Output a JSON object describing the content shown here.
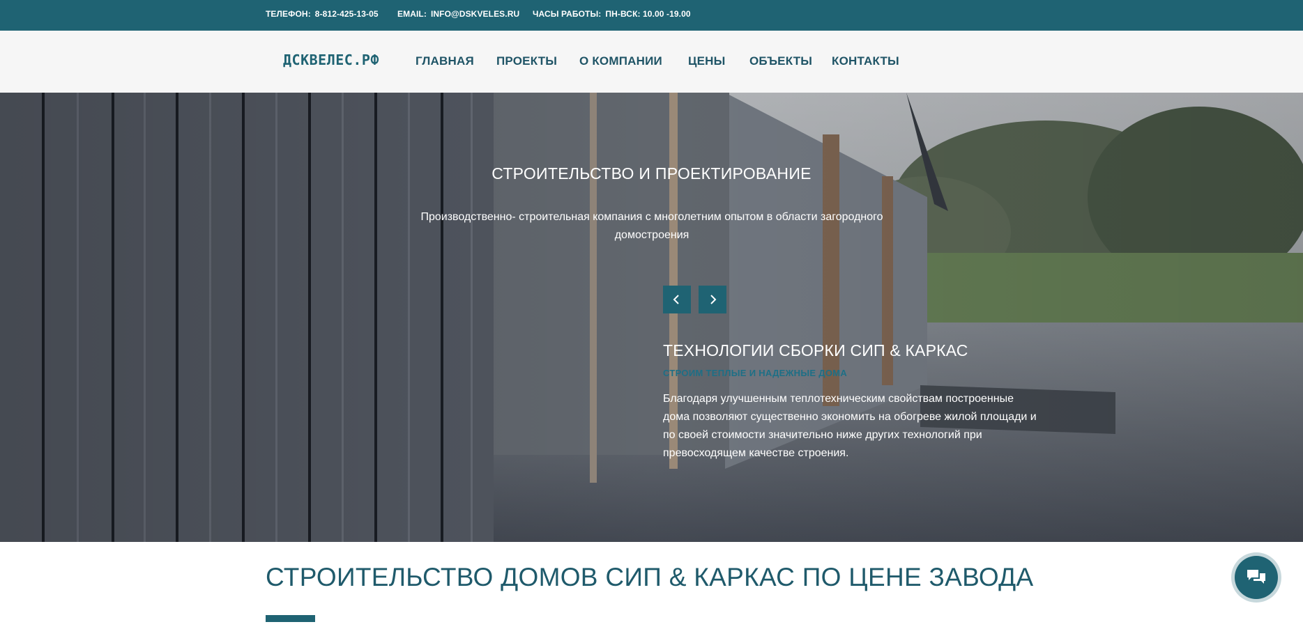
{
  "topbar": {
    "phone_label": "ТЕЛЕФОН:",
    "phone_value": "8-812-425-13-05",
    "email_label": "EMAIL:",
    "email_value": "INFO@DSKVELES.RU",
    "hours_label": "ЧАСЫ РАБОТЫ:",
    "hours_value": "ПН-ВСК: 10.00 -19.00"
  },
  "header": {
    "logo": "ДСКВЕЛЕС.РФ",
    "nav": [
      "ГЛАВНАЯ",
      "ПРОЕКТЫ",
      "О КОМПАНИИ",
      "ЦЕНЫ",
      "ОБЪЕКТЫ",
      "КОНТАКТЫ"
    ]
  },
  "hero": {
    "title": "СТРОИТЕЛЬСТВО И ПРОЕКТИРОВАНИЕ",
    "subtitle": "Производственно- строительная компания с многолетним опытом в области загородного домостроения",
    "prev_icon": "chevron-left-icon",
    "next_icon": "chevron-right-icon",
    "tech_title": "ТЕХНОЛОГИИ СБОРКИ СИП & КАРКАС",
    "tech_subtitle": "СТРОИМ ТЕПЛЫЕ И НАДЕЖНЫЕ ДОМА",
    "tech_text": "Благодаря улучшенным теплотехническим свойствам построенные дома позволяют существенно экономить на обогреве жилой площади и по своей стоимости значительно ниже других технологий при превосходящем качестве строения."
  },
  "main": {
    "section_title": "СТРОИТЕЛЬСТВО ДОМОВ СИП & КАРКАС ПО ЦЕНЕ ЗАВОДА"
  },
  "chat": {
    "icon": "chat-bubbles-icon"
  },
  "colors": {
    "brand": "#1f6373",
    "nav_text": "#1f5466",
    "navbar_bg": "#f6f6f6"
  }
}
